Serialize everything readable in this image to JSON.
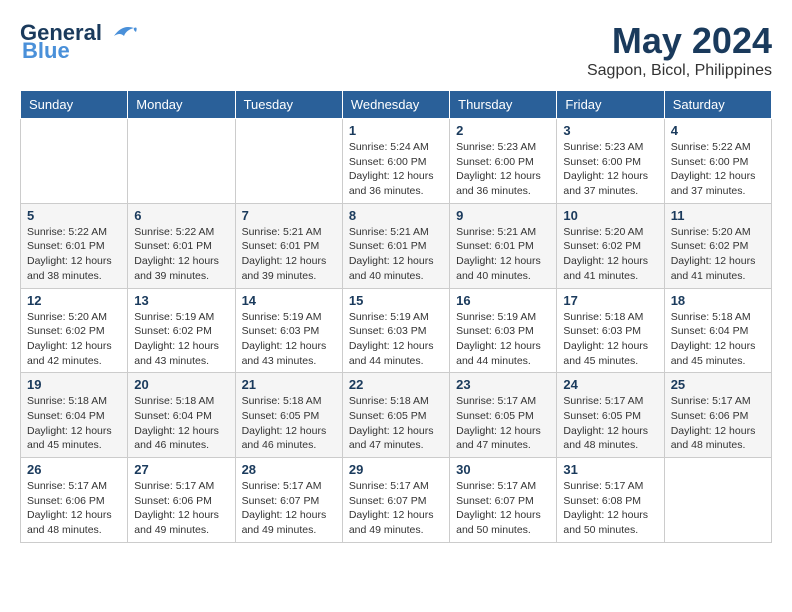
{
  "header": {
    "logo_general": "General",
    "logo_blue": "Blue",
    "month": "May 2024",
    "location": "Sagpon, Bicol, Philippines"
  },
  "weekdays": [
    "Sunday",
    "Monday",
    "Tuesday",
    "Wednesday",
    "Thursday",
    "Friday",
    "Saturday"
  ],
  "weeks": [
    [
      {
        "day": "",
        "info": ""
      },
      {
        "day": "",
        "info": ""
      },
      {
        "day": "",
        "info": ""
      },
      {
        "day": "1",
        "info": "Sunrise: 5:24 AM\nSunset: 6:00 PM\nDaylight: 12 hours\nand 36 minutes."
      },
      {
        "day": "2",
        "info": "Sunrise: 5:23 AM\nSunset: 6:00 PM\nDaylight: 12 hours\nand 36 minutes."
      },
      {
        "day": "3",
        "info": "Sunrise: 5:23 AM\nSunset: 6:00 PM\nDaylight: 12 hours\nand 37 minutes."
      },
      {
        "day": "4",
        "info": "Sunrise: 5:22 AM\nSunset: 6:00 PM\nDaylight: 12 hours\nand 37 minutes."
      }
    ],
    [
      {
        "day": "5",
        "info": "Sunrise: 5:22 AM\nSunset: 6:01 PM\nDaylight: 12 hours\nand 38 minutes."
      },
      {
        "day": "6",
        "info": "Sunrise: 5:22 AM\nSunset: 6:01 PM\nDaylight: 12 hours\nand 39 minutes."
      },
      {
        "day": "7",
        "info": "Sunrise: 5:21 AM\nSunset: 6:01 PM\nDaylight: 12 hours\nand 39 minutes."
      },
      {
        "day": "8",
        "info": "Sunrise: 5:21 AM\nSunset: 6:01 PM\nDaylight: 12 hours\nand 40 minutes."
      },
      {
        "day": "9",
        "info": "Sunrise: 5:21 AM\nSunset: 6:01 PM\nDaylight: 12 hours\nand 40 minutes."
      },
      {
        "day": "10",
        "info": "Sunrise: 5:20 AM\nSunset: 6:02 PM\nDaylight: 12 hours\nand 41 minutes."
      },
      {
        "day": "11",
        "info": "Sunrise: 5:20 AM\nSunset: 6:02 PM\nDaylight: 12 hours\nand 41 minutes."
      }
    ],
    [
      {
        "day": "12",
        "info": "Sunrise: 5:20 AM\nSunset: 6:02 PM\nDaylight: 12 hours\nand 42 minutes."
      },
      {
        "day": "13",
        "info": "Sunrise: 5:19 AM\nSunset: 6:02 PM\nDaylight: 12 hours\nand 43 minutes."
      },
      {
        "day": "14",
        "info": "Sunrise: 5:19 AM\nSunset: 6:03 PM\nDaylight: 12 hours\nand 43 minutes."
      },
      {
        "day": "15",
        "info": "Sunrise: 5:19 AM\nSunset: 6:03 PM\nDaylight: 12 hours\nand 44 minutes."
      },
      {
        "day": "16",
        "info": "Sunrise: 5:19 AM\nSunset: 6:03 PM\nDaylight: 12 hours\nand 44 minutes."
      },
      {
        "day": "17",
        "info": "Sunrise: 5:18 AM\nSunset: 6:03 PM\nDaylight: 12 hours\nand 45 minutes."
      },
      {
        "day": "18",
        "info": "Sunrise: 5:18 AM\nSunset: 6:04 PM\nDaylight: 12 hours\nand 45 minutes."
      }
    ],
    [
      {
        "day": "19",
        "info": "Sunrise: 5:18 AM\nSunset: 6:04 PM\nDaylight: 12 hours\nand 45 minutes."
      },
      {
        "day": "20",
        "info": "Sunrise: 5:18 AM\nSunset: 6:04 PM\nDaylight: 12 hours\nand 46 minutes."
      },
      {
        "day": "21",
        "info": "Sunrise: 5:18 AM\nSunset: 6:05 PM\nDaylight: 12 hours\nand 46 minutes."
      },
      {
        "day": "22",
        "info": "Sunrise: 5:18 AM\nSunset: 6:05 PM\nDaylight: 12 hours\nand 47 minutes."
      },
      {
        "day": "23",
        "info": "Sunrise: 5:17 AM\nSunset: 6:05 PM\nDaylight: 12 hours\nand 47 minutes."
      },
      {
        "day": "24",
        "info": "Sunrise: 5:17 AM\nSunset: 6:05 PM\nDaylight: 12 hours\nand 48 minutes."
      },
      {
        "day": "25",
        "info": "Sunrise: 5:17 AM\nSunset: 6:06 PM\nDaylight: 12 hours\nand 48 minutes."
      }
    ],
    [
      {
        "day": "26",
        "info": "Sunrise: 5:17 AM\nSunset: 6:06 PM\nDaylight: 12 hours\nand 48 minutes."
      },
      {
        "day": "27",
        "info": "Sunrise: 5:17 AM\nSunset: 6:06 PM\nDaylight: 12 hours\nand 49 minutes."
      },
      {
        "day": "28",
        "info": "Sunrise: 5:17 AM\nSunset: 6:07 PM\nDaylight: 12 hours\nand 49 minutes."
      },
      {
        "day": "29",
        "info": "Sunrise: 5:17 AM\nSunset: 6:07 PM\nDaylight: 12 hours\nand 49 minutes."
      },
      {
        "day": "30",
        "info": "Sunrise: 5:17 AM\nSunset: 6:07 PM\nDaylight: 12 hours\nand 50 minutes."
      },
      {
        "day": "31",
        "info": "Sunrise: 5:17 AM\nSunset: 6:08 PM\nDaylight: 12 hours\nand 50 minutes."
      },
      {
        "day": "",
        "info": ""
      }
    ]
  ]
}
